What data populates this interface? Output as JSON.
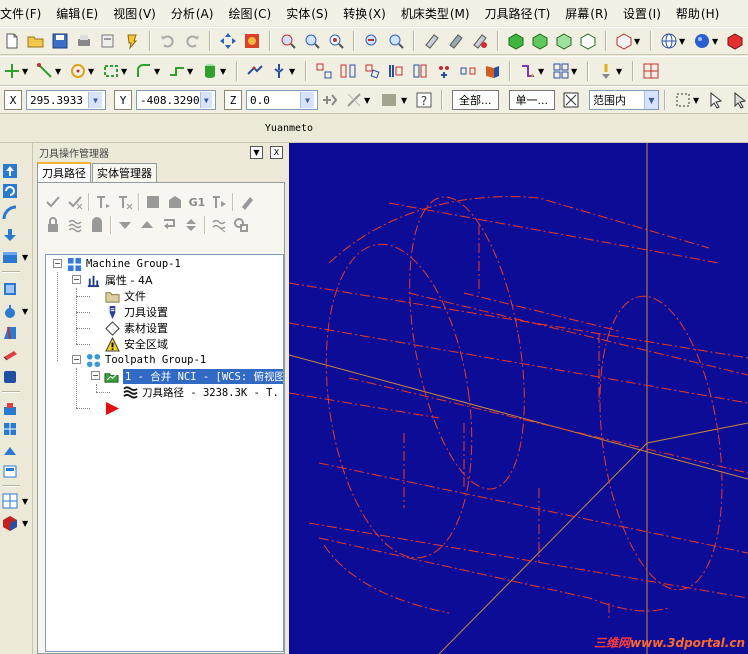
{
  "menu": [
    {
      "label": "文件",
      "acc": "(F)"
    },
    {
      "label": "编辑",
      "acc": "(E)"
    },
    {
      "label": "视图",
      "acc": "(V)"
    },
    {
      "label": "分析",
      "acc": "(A)"
    },
    {
      "label": "绘图",
      "acc": "(C)"
    },
    {
      "label": "实体",
      "acc": "(S)"
    },
    {
      "label": "转换",
      "acc": "(X)"
    },
    {
      "label": "机床类型",
      "acc": "(M)"
    },
    {
      "label": "刀具路径",
      "acc": "(T)"
    },
    {
      "label": "屏幕",
      "acc": "(R)"
    },
    {
      "label": "设置",
      "acc": "(I)"
    },
    {
      "label": "帮助",
      "acc": "(H)"
    }
  ],
  "coords": {
    "x_label": "X",
    "x_value": "295.3933",
    "y_label": "Y",
    "y_value": "-408.3290",
    "z_label": "Z",
    "z_value": "0.0",
    "all_button": "全部...",
    "single_button": "单一...",
    "range_select": "范围内"
  },
  "title_strip": "Yuanmeto",
  "panel": {
    "title": "刀具操作管理器",
    "close_glyph": "X",
    "tabs": [
      "刀具路径",
      "实体管理器"
    ],
    "g1_label": "G1"
  },
  "tree": {
    "machine_group": "Machine Group-1",
    "properties": "属性 - 4A",
    "files": "文件",
    "tool_settings": "刀具设置",
    "stock_setup": "素材设置",
    "safety_zone": "安全区域",
    "toolpath_group": "Toolpath Group-1",
    "operation": "1 - 合并 NCI - [WCS: 俯视图",
    "toolpath": "刀具路径 - 3238.3K - T."
  },
  "colors": {
    "viewport_bg": "#0c0c96",
    "wireframe": "#e83a28",
    "axis": "#c8883a",
    "selected": "#316ac5"
  },
  "watermark": {
    "cn": "三维网",
    "url": "www.3dportal.cn"
  }
}
